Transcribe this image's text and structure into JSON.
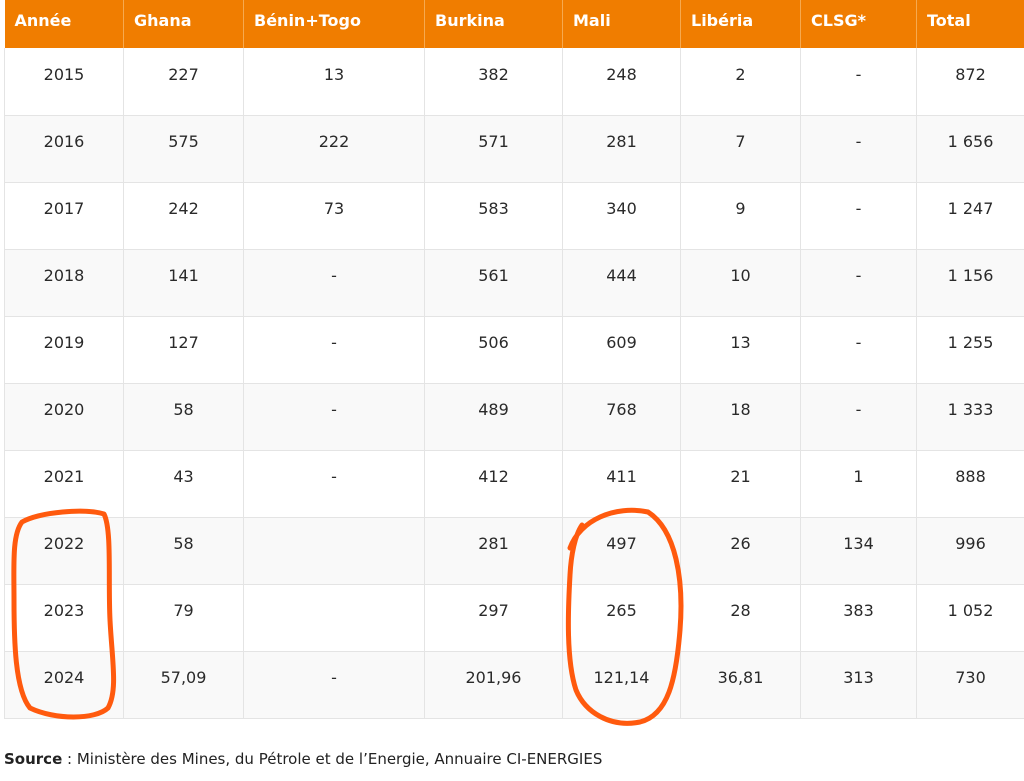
{
  "table": {
    "headers": [
      "Année",
      "Ghana",
      "Bénin+Togo",
      "Burkina",
      "Mali",
      "Libéria",
      "CLSG*",
      "Total"
    ],
    "rows": [
      [
        "2015",
        "227",
        "13",
        "382",
        "248",
        "2",
        "-",
        "872"
      ],
      [
        "2016",
        "575",
        "222",
        "571",
        "281",
        "7",
        "-",
        "1 656"
      ],
      [
        "2017",
        "242",
        "73",
        "583",
        "340",
        "9",
        "-",
        "1 247"
      ],
      [
        "2018",
        "141",
        "-",
        "561",
        "444",
        "10",
        "-",
        "1 156"
      ],
      [
        "2019",
        "127",
        "-",
        "506",
        "609",
        "13",
        "-",
        "1 255"
      ],
      [
        "2020",
        "58",
        "-",
        "489",
        "768",
        "18",
        "-",
        "1 333"
      ],
      [
        "2021",
        "43",
        "-",
        "412",
        "411",
        "21",
        "1",
        "888"
      ],
      [
        "2022",
        "58",
        "",
        "281",
        "497",
        "26",
        "134",
        "996"
      ],
      [
        "2023",
        "79",
        "",
        "297",
        "265",
        "28",
        "383",
        "1 052"
      ],
      [
        "2024",
        "57,09",
        "-",
        "201,96",
        "121,14",
        "36,81",
        "313",
        "730"
      ]
    ]
  },
  "source": {
    "label": "Source",
    "text": " : Ministère des Mines, du Pétrole et de l’Energie, Annuaire CI-ENERGIES"
  },
  "annotations": {
    "color": "#ff5a0e",
    "circled": [
      "2022–2024 years",
      "Mali 2022–2024"
    ]
  }
}
